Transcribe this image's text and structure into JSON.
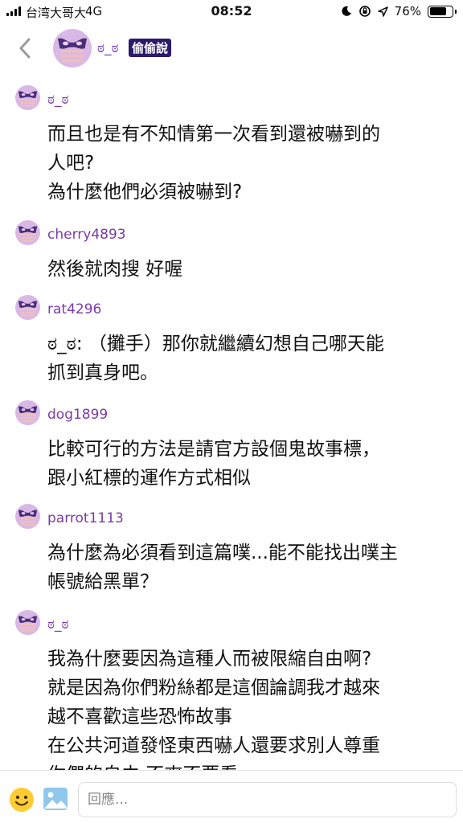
{
  "status": {
    "carrier": "台湾大哥大",
    "network": "4G",
    "time": "08:52",
    "battery": "76%",
    "battery_level": 0.76
  },
  "header": {
    "name": "ಠ_ಠ",
    "badge": "偷偷說"
  },
  "comments": [
    {
      "username": "ಠ_ಠ",
      "text": "而且也是有不知情第一次看到還被嚇到的\n人吧?\n為什麼他們必須被嚇到?"
    },
    {
      "username": "cherry4893",
      "text": "然後就肉搜 好喔"
    },
    {
      "username": "rat4296",
      "text": "ಠ_ಠ: （攤手）那你就繼續幻想自己哪天能\n抓到真身吧。"
    },
    {
      "username": "dog1899",
      "text": "比較可行的方法是請官方設個鬼故事標，\n跟小紅標的運作方式相似"
    },
    {
      "username": "parrot1113",
      "text": "為什麼為必須看到這篇噗...能不能找出噗主\n帳號給黑單？"
    },
    {
      "username": "ಠ_ಠ",
      "text": "我為什麼要因為這種人而被限縮自由啊?\n就是因為你們粉絲都是這個論調我才越來\n越不喜歡這些恐怖故事\n在公共河道發怪東西嚇人還要求別人尊重\n你們的自由 不爽不要看"
    }
  ],
  "reply": {
    "placeholder": "回應..."
  },
  "colors": {
    "username": "#7b3aa8",
    "badge_bg": "#2d1a6b",
    "avatar_bg": "#d9b8e6",
    "avatar_mask": "#4a2d7a",
    "avatar_stripes": "#f0c0b8"
  }
}
